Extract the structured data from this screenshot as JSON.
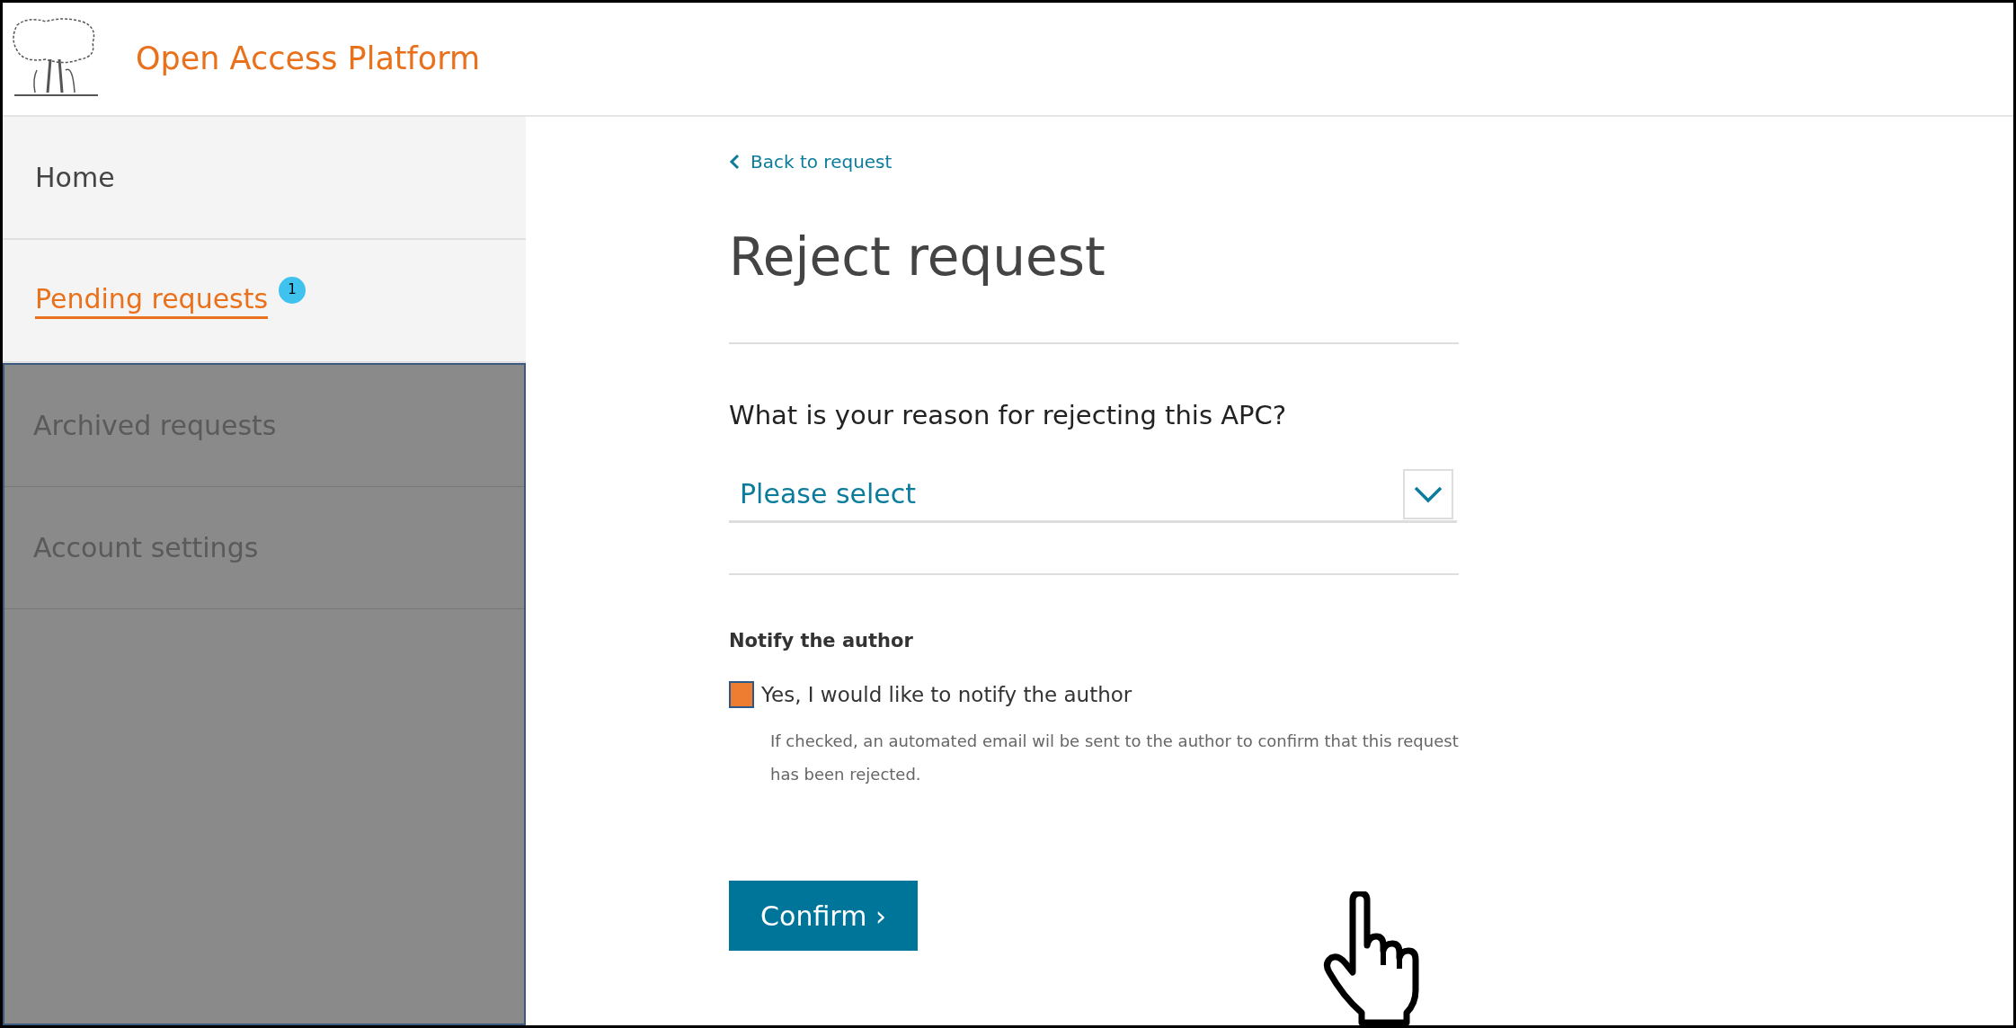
{
  "header": {
    "title": "Open Access Platform"
  },
  "sidebar": {
    "items": [
      {
        "label": "Home",
        "selected": false
      },
      {
        "label": "Pending requests",
        "selected": true,
        "badge": "1"
      }
    ],
    "dimmed_items": [
      {
        "label": "Archived requests"
      },
      {
        "label": "Account settings"
      }
    ]
  },
  "back_link": "Back to request",
  "title": "Reject request",
  "question": "What is your reason for rejecting this APC?",
  "select": {
    "placeholder": "Please select"
  },
  "notify": {
    "heading": "Notify the author",
    "checkbox_label": "Yes, I would like to notify the author",
    "checked": true,
    "help": "If checked, an automated email wil be sent to the author to confirm that this request has been rejected."
  },
  "confirm_button": "Confirm ›"
}
